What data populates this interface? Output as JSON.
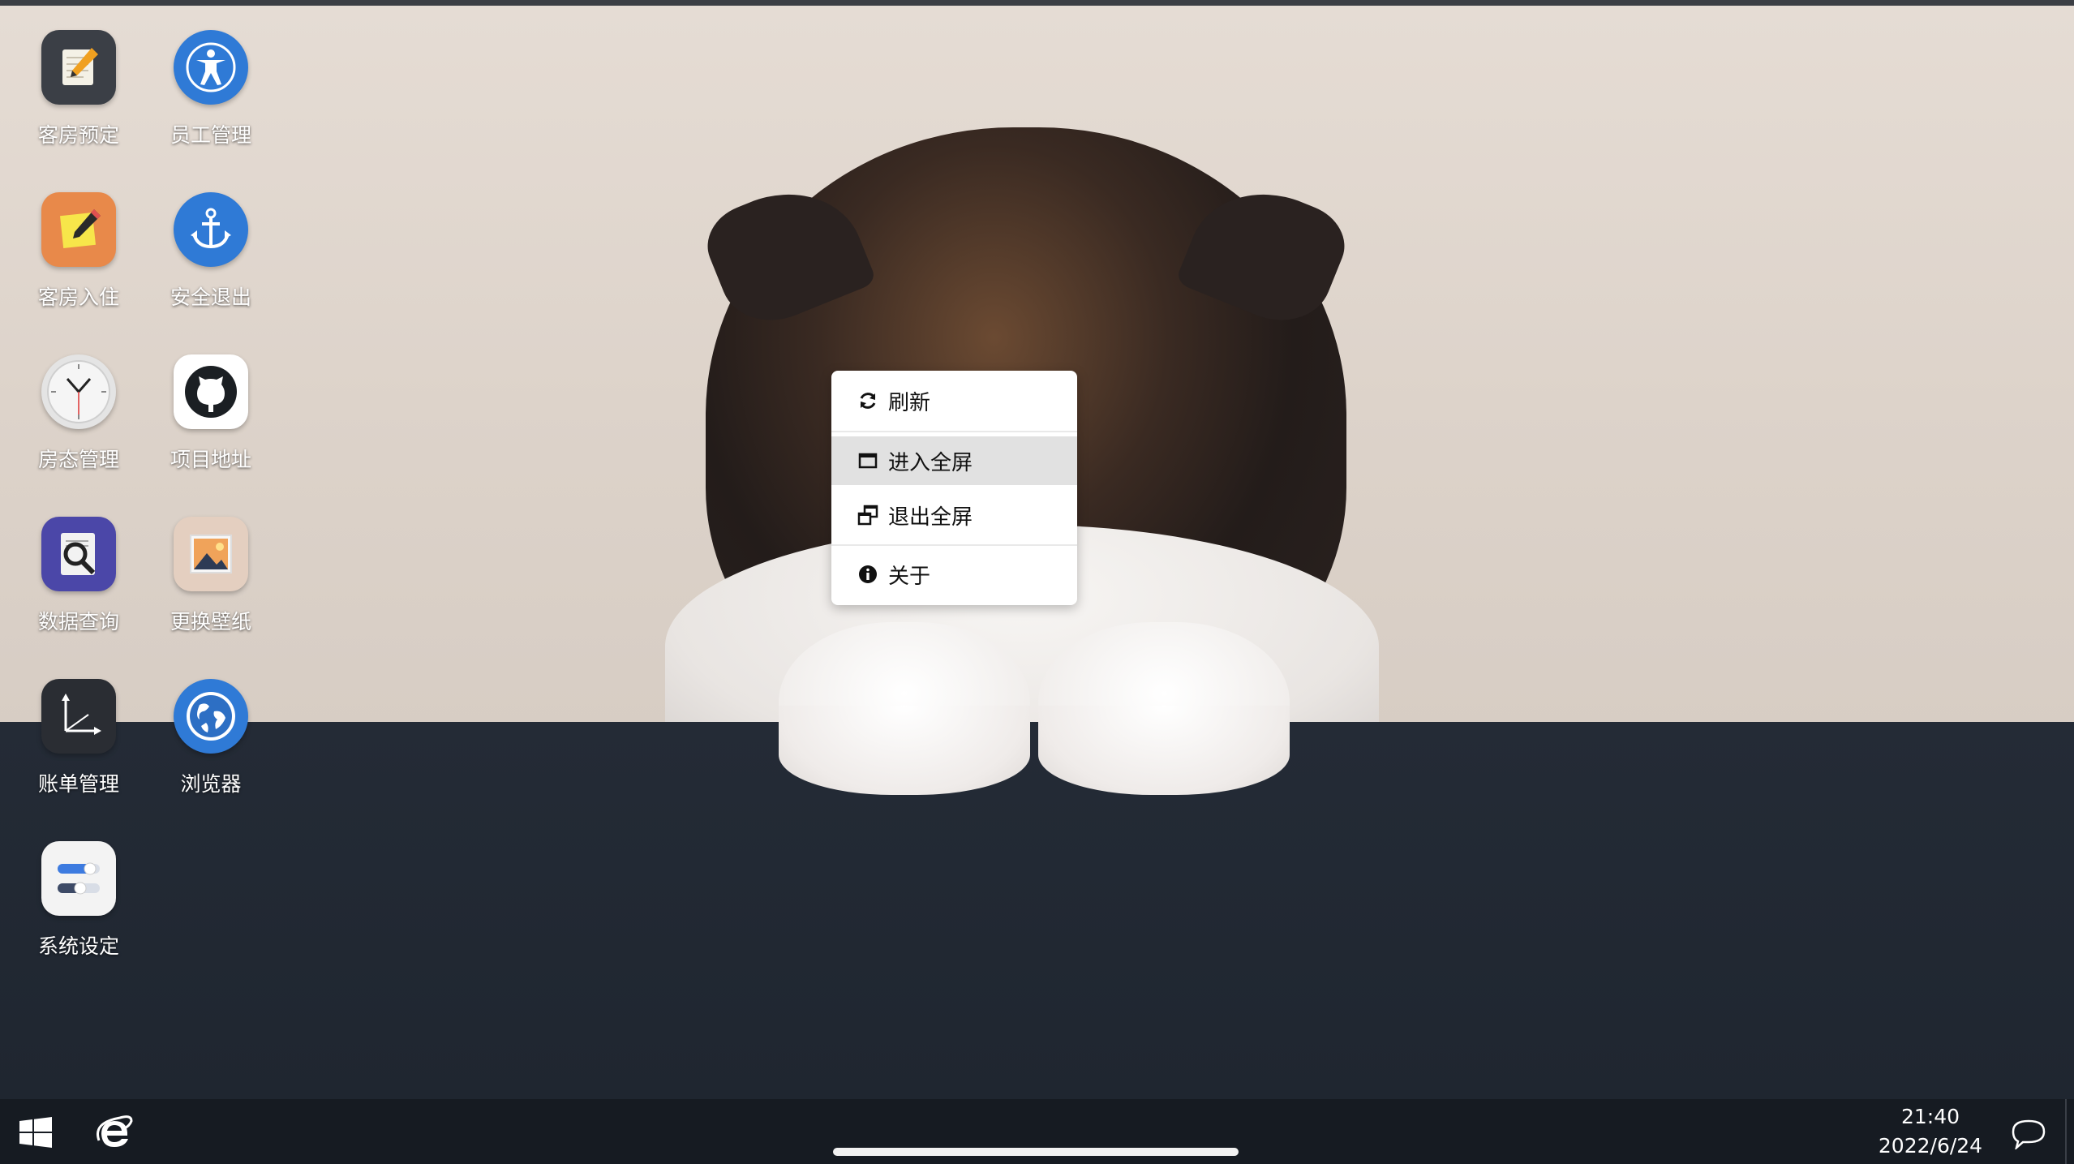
{
  "desktop": {
    "icons": [
      {
        "label": "客房预定",
        "icon": "notepad-pencil-icon"
      },
      {
        "label": "员工管理",
        "icon": "accessibility-person-icon"
      },
      {
        "label": "客房入住",
        "icon": "note-pencil-icon"
      },
      {
        "label": "安全退出",
        "icon": "anchor-icon"
      },
      {
        "label": "房态管理",
        "icon": "clock-icon"
      },
      {
        "label": "项目地址",
        "icon": "github-icon"
      },
      {
        "label": "数据查询",
        "icon": "search-document-icon"
      },
      {
        "label": "更换壁纸",
        "icon": "picture-icon"
      },
      {
        "label": "账单管理",
        "icon": "axes-arrow-icon"
      },
      {
        "label": "浏览器",
        "icon": "globe-icon"
      },
      {
        "label": "系统设定",
        "icon": "toggle-settings-icon"
      }
    ]
  },
  "context_menu": {
    "items": [
      {
        "label": "刷新",
        "icon": "refresh-icon"
      },
      {
        "label": "进入全屏",
        "icon": "window-maximize-icon",
        "highlighted": true
      },
      {
        "label": "退出全屏",
        "icon": "window-restore-icon"
      },
      {
        "label": "关于",
        "icon": "info-circle-icon"
      }
    ]
  },
  "taskbar": {
    "time": "21:40",
    "date": "2022/6/24",
    "start_icon": "windows-logo-icon",
    "browser_icon": "internet-explorer-icon",
    "notification_icon": "chat-bubble-icon"
  },
  "colors": {
    "desktop_background": "#1f2631",
    "taskbar": "#161b22",
    "menu_highlight": "#e1e1e1"
  }
}
